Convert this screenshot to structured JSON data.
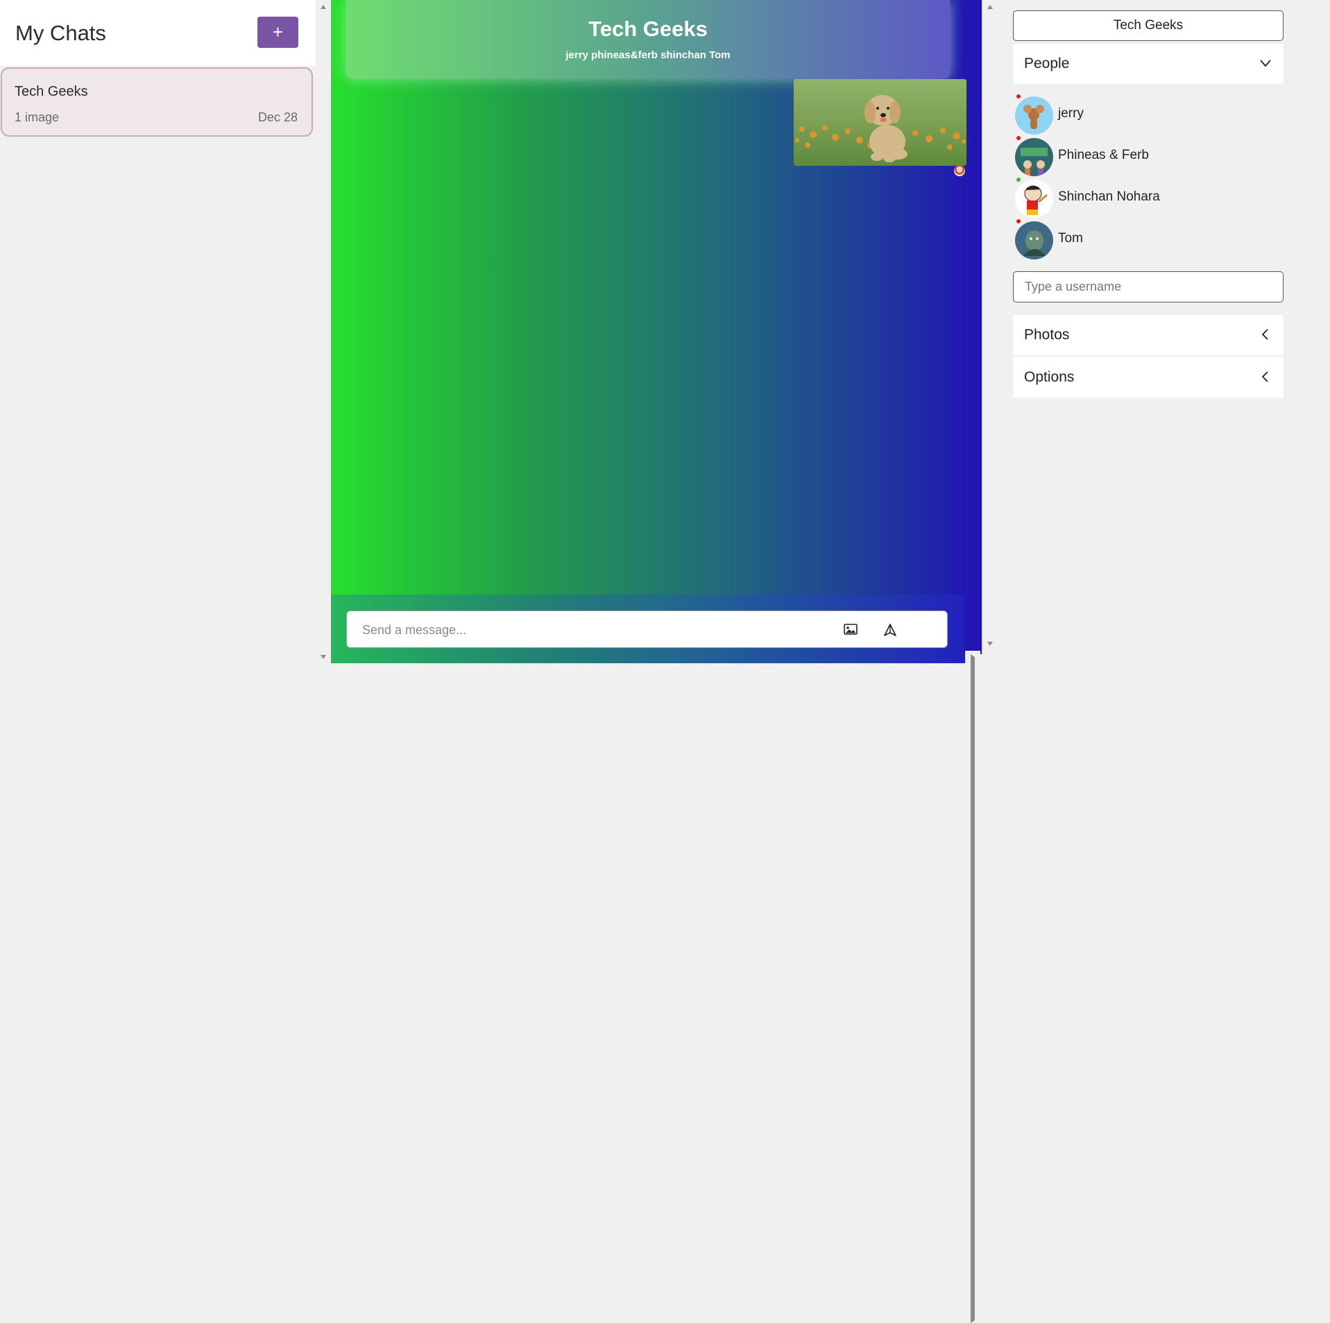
{
  "sidebar": {
    "title": "My Chats",
    "new_chat_label": "+",
    "chats": [
      {
        "name": "Tech Geeks",
        "preview": "1 image",
        "date": "Dec 28"
      }
    ]
  },
  "chat": {
    "title": "Tech Geeks",
    "members": "jerry phineas&ferb shinchan Tom",
    "messages": [
      {
        "type": "image",
        "alt": "golden retriever puppy in flower field"
      }
    ],
    "composer": {
      "placeholder": "Send a message..."
    }
  },
  "details": {
    "group_name": "Tech Geeks",
    "people_label": "People",
    "people": [
      {
        "name": "jerry",
        "status_color": "#e01818"
      },
      {
        "name": "Phineas & Ferb",
        "status_color": "#e01818"
      },
      {
        "name": "Shinchan Nohara",
        "status_color": "#2ec02e"
      },
      {
        "name": "Tom",
        "status_color": "#e01818"
      }
    ],
    "username_placeholder": "Type a username",
    "photos_label": "Photos",
    "options_label": "Options"
  },
  "colors": {
    "accent": "#7a55a6",
    "chat_item_bg": "#f0e8e8",
    "chat_item_border": "#c9a9b6",
    "gradient_start": "#26e02c",
    "gradient_end": "#2212b6"
  }
}
